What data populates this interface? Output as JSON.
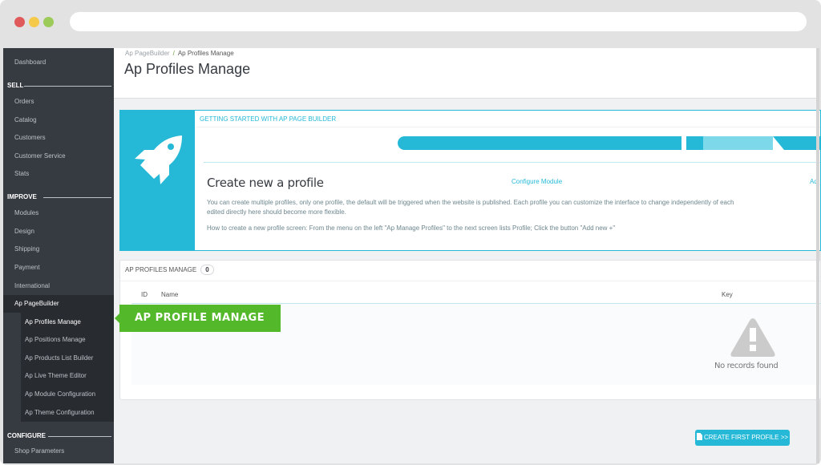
{
  "window": {
    "controls": [
      "close",
      "minimize",
      "maximize"
    ],
    "url": ""
  },
  "sidebar": {
    "dashboard": "Dashboard",
    "sections": [
      {
        "title": "SELL",
        "items": [
          "Orders",
          "Catalog",
          "Customers",
          "Customer Service",
          "Stats"
        ]
      },
      {
        "title": "IMPROVE",
        "items": [
          "Modules",
          "Design",
          "Shipping",
          "Payment",
          "International",
          "Ap PageBuilder"
        ]
      },
      {
        "title": "CONFIGURE",
        "items": [
          "Shop Parameters"
        ]
      }
    ],
    "submenu": [
      "Ap Profiles Manage",
      "Ap Positions Manage",
      "Ap Products List Builder",
      "Ap Live Theme Editor",
      "Ap Module Configuration",
      "Ap Theme Configuration"
    ],
    "active_parent": "Ap PageBuilder",
    "active_item": "Ap Profiles Manage"
  },
  "header": {
    "breadcrumb": [
      "Ap PageBuilder",
      "Ap Profiles Manage"
    ],
    "breadcrumb_separator": "/",
    "title": "Ap Profiles Manage"
  },
  "getting_started": {
    "heading": "GETTING STARTED WITH AP PAGE BUILDER",
    "icon": "rocket-icon",
    "steps": [
      {
        "label": "Configure Module",
        "status": "complete"
      },
      {
        "label": "Ad",
        "status": "in-progress"
      }
    ],
    "title": "Create new a profile",
    "paragraph1": "You can create multiple profiles, only one profile, the default will be triggered when the website is published. Each profile you can customize the interface to change independently of each",
    "paragraph1_cont": "edited directly here should become more flexible.",
    "paragraph2": "How to create a new profile screen: From the menu on the left \"Ap Manage Profiles\" to the next screen lists Profile; Click the button \"Add new +\""
  },
  "profiles_list": {
    "heading": "AP PROFILES MANAGE",
    "count": "0",
    "columns": [
      "ID",
      "Name",
      "Key"
    ],
    "rows": [],
    "empty_icon": "warning-icon",
    "empty_text": "No records found"
  },
  "callout": {
    "label": "AP PROFILE MANAGE",
    "color": "#54b82b"
  },
  "actions": {
    "create_first_profile": "CREATE FIRST PROFILE >>"
  },
  "colors": {
    "accent": "#25b9d7",
    "sidebar_bg": "#363a41",
    "callout_green": "#54b82b"
  }
}
